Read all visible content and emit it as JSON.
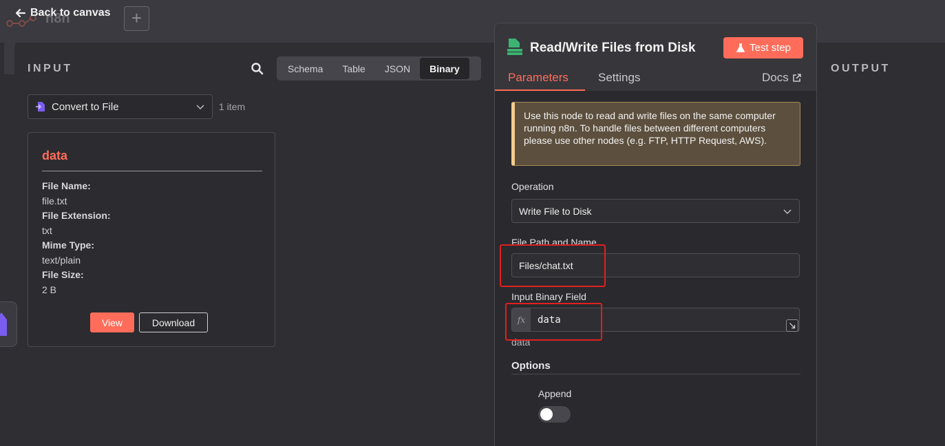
{
  "topbar": {
    "logo_text": "n8n",
    "back_label": "Back to canvas",
    "plus_label": "+"
  },
  "input": {
    "title": "INPUT",
    "tabs": [
      "Schema",
      "Table",
      "JSON",
      "Binary"
    ],
    "active_tab": "Binary",
    "node_select": "Convert to File",
    "item_count": "1 item",
    "binary": {
      "title": "data",
      "fields": [
        {
          "label": "File Name:",
          "value": "file.txt"
        },
        {
          "label": "File Extension:",
          "value": "txt"
        },
        {
          "label": "Mime Type:",
          "value": "text/plain"
        },
        {
          "label": "File Size:",
          "value": "2 B"
        }
      ],
      "view_label": "View",
      "download_label": "Download"
    }
  },
  "output": {
    "title": "OUTPUT"
  },
  "node": {
    "title": "Read/Write Files from Disk",
    "test_label": "Test step",
    "tabs": {
      "parameters": "Parameters",
      "settings": "Settings",
      "docs": "Docs"
    },
    "notice": "Use this node to read and write files on the same computer running n8n. To handle files between different computers please use other nodes (e.g. FTP, HTTP Request, AWS).",
    "operation_label": "Operation",
    "operation_value": "Write File to Disk",
    "path_label": "File Path and Name",
    "path_value": "Files/chat.txt",
    "binary_field_label": "Input Binary Field",
    "binary_field_fx": "fx",
    "binary_field_value": "data",
    "binary_field_hint": "data",
    "options_label": "Options",
    "append_label": "Append",
    "append_on": false
  },
  "colors": {
    "accent": "#ff6d5a",
    "panel_bg": "#2e2e33",
    "highlight": "#e0201f"
  }
}
